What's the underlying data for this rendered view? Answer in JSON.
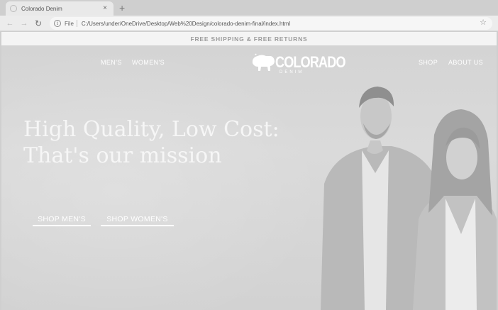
{
  "browser": {
    "tab_title": "Colorado Denim",
    "tab_close": "×",
    "new_tab": "+",
    "back": "←",
    "forward": "→",
    "reload": "↻",
    "scheme_label": "File",
    "url": "C:/Users/under/OneDrive/Desktop/Web%20Design/colorado-denim-final/index.html",
    "info_glyph": "i",
    "star": "☆"
  },
  "promo": {
    "text": "FREE SHIPPING & FREE RETURNS"
  },
  "nav": {
    "left": [
      "MEN'S",
      "WOMEN'S"
    ],
    "right": [
      "SHOP",
      "ABOUT US"
    ]
  },
  "logo": {
    "word": "COLORADO",
    "sub": "DENIM"
  },
  "hero": {
    "headline_line1": "High Quality, Low Cost:",
    "headline_line2": "That's our mission",
    "cta_men": "SHOP MEN'S",
    "cta_women": "SHOP WOMEN'S"
  },
  "colors": {
    "chrome_bg": "#cfcfcf",
    "promo_bg": "#f4f4f4",
    "promo_text": "#9c9c9c",
    "hero_text": "#ffffff"
  }
}
